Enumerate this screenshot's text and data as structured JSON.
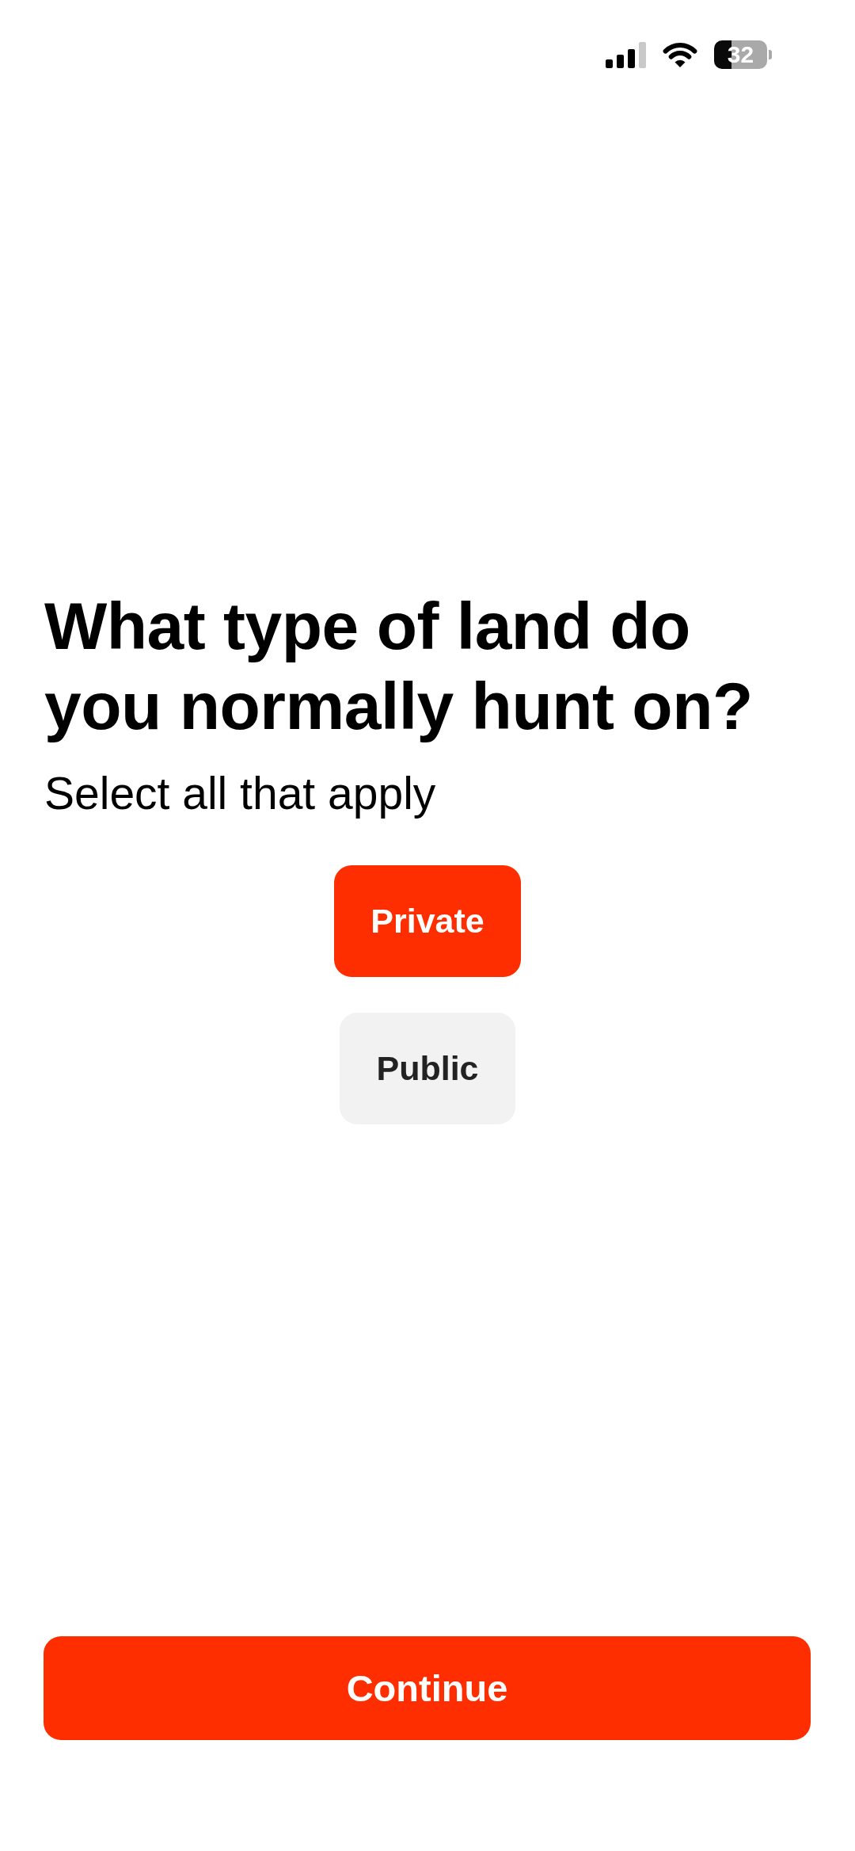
{
  "status_bar": {
    "battery": "32"
  },
  "question": {
    "title": "What type of land do you normally hunt on?",
    "subtitle": "Select all that apply"
  },
  "options": [
    {
      "label": "Private",
      "selected": true
    },
    {
      "label": "Public",
      "selected": false
    }
  ],
  "continue_button": {
    "label": "Continue"
  }
}
